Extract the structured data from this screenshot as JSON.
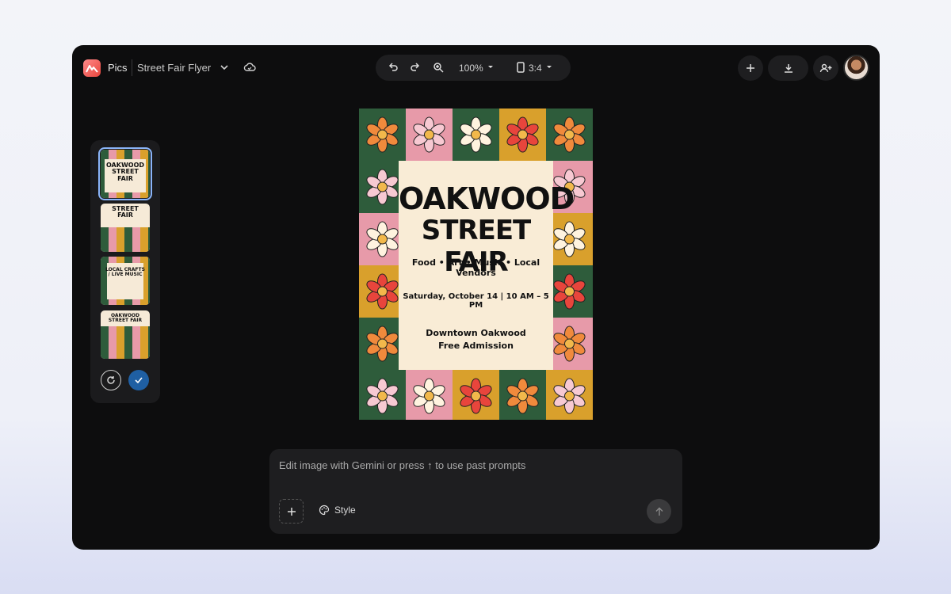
{
  "header": {
    "app_name": "Pics",
    "document_title": "Street Fair Flyer",
    "zoom": "100%",
    "aspect_ratio": "3:4"
  },
  "thumbnails": [
    {
      "title": "OAKWOOD STREET FAIR",
      "selected": true
    },
    {
      "title": "STREET FAIR",
      "selected": false
    },
    {
      "title": "LOCAL CRAFTS / LIVE MUSIC",
      "selected": false
    },
    {
      "title": "OAKWOOD STREET FAIR",
      "selected": false
    }
  ],
  "flyer": {
    "title_line1": "OAKWOOD",
    "title_line2": "STREET FAIR",
    "subtitle": "Food • Art • Music • Local Vendors",
    "date": "Saturday, October 14 | 10 AM – 5 PM",
    "location_line1": "Downtown Oakwood",
    "location_line2": "Free Admission"
  },
  "prompt": {
    "placeholder": "Edit image with Gemini or press ↑ to use past prompts",
    "style_label": "Style"
  },
  "colors": {
    "green": "#2e5c3b",
    "pink": "#e79aa9",
    "mustard": "#d9a02c",
    "cream": "#f9ecd6",
    "accent_blue": "#1f5fa3"
  }
}
